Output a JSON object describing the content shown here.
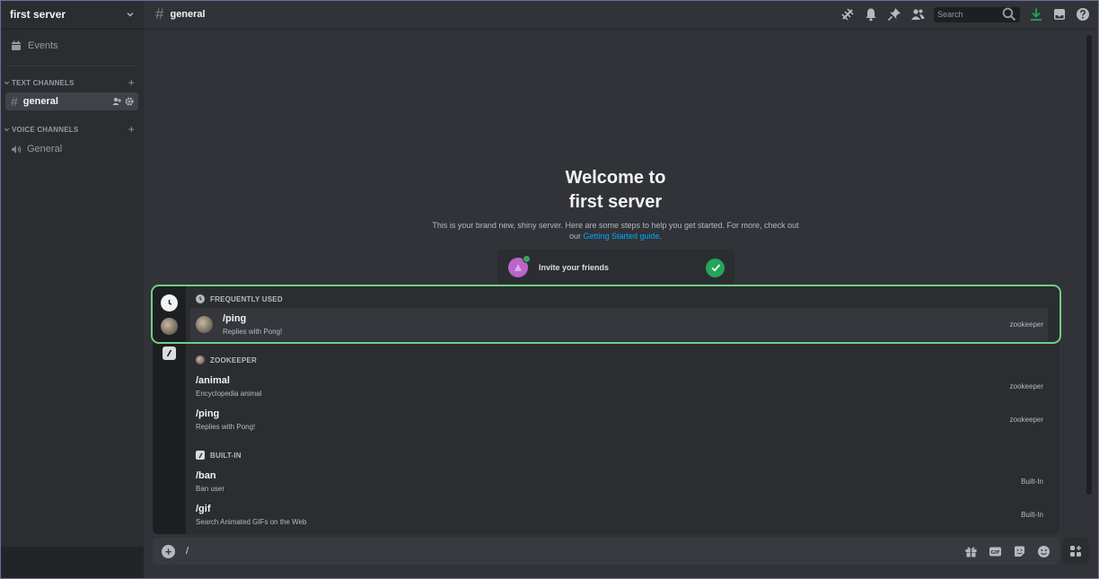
{
  "sidebar": {
    "server_name": "first server",
    "events_label": "Events",
    "text_category": "TEXT CHANNELS",
    "text_channels": [
      {
        "name": "general"
      }
    ],
    "voice_category": "VOICE CHANNELS",
    "voice_channels": [
      {
        "name": "General"
      }
    ]
  },
  "topbar": {
    "channel_name": "general",
    "search_placeholder": "Search"
  },
  "welcome": {
    "title_line1": "Welcome to",
    "title_line2": "first server",
    "desc_prefix": "This is your brand new, shiny server. Here are some steps to help you get started. For more, check out our ",
    "desc_link": "Getting Started guide",
    "desc_suffix": ".",
    "invite_label": "Invite your friends"
  },
  "autocomplete": {
    "sections": [
      {
        "header": "FREQUENTLY USED",
        "icon": "clock-icon",
        "commands": [
          {
            "name": "/ping",
            "description": "Replies with Pong!",
            "source": "zookeeper",
            "selected": true
          }
        ]
      },
      {
        "header": "ZOOKEEPER",
        "icon": "bot-avatar",
        "commands": [
          {
            "name": "/animal",
            "description": "Encyclopedia animal",
            "source": "zookeeper"
          },
          {
            "name": "/ping",
            "description": "Replies with Pong!",
            "source": "zookeeper"
          }
        ]
      },
      {
        "header": "BUILT-IN",
        "icon": "slash-icon",
        "commands": [
          {
            "name": "/ban",
            "description": "Ban user",
            "source": "Built-In"
          },
          {
            "name": "/gif",
            "description": "Search Animated GIFs on the Web",
            "source": "Built-In"
          }
        ]
      }
    ]
  },
  "composer": {
    "value": "/"
  },
  "colors": {
    "accent_green": "#23a55a",
    "highlight_outline": "#6fcf7f",
    "link_blue": "#00a8fc"
  }
}
